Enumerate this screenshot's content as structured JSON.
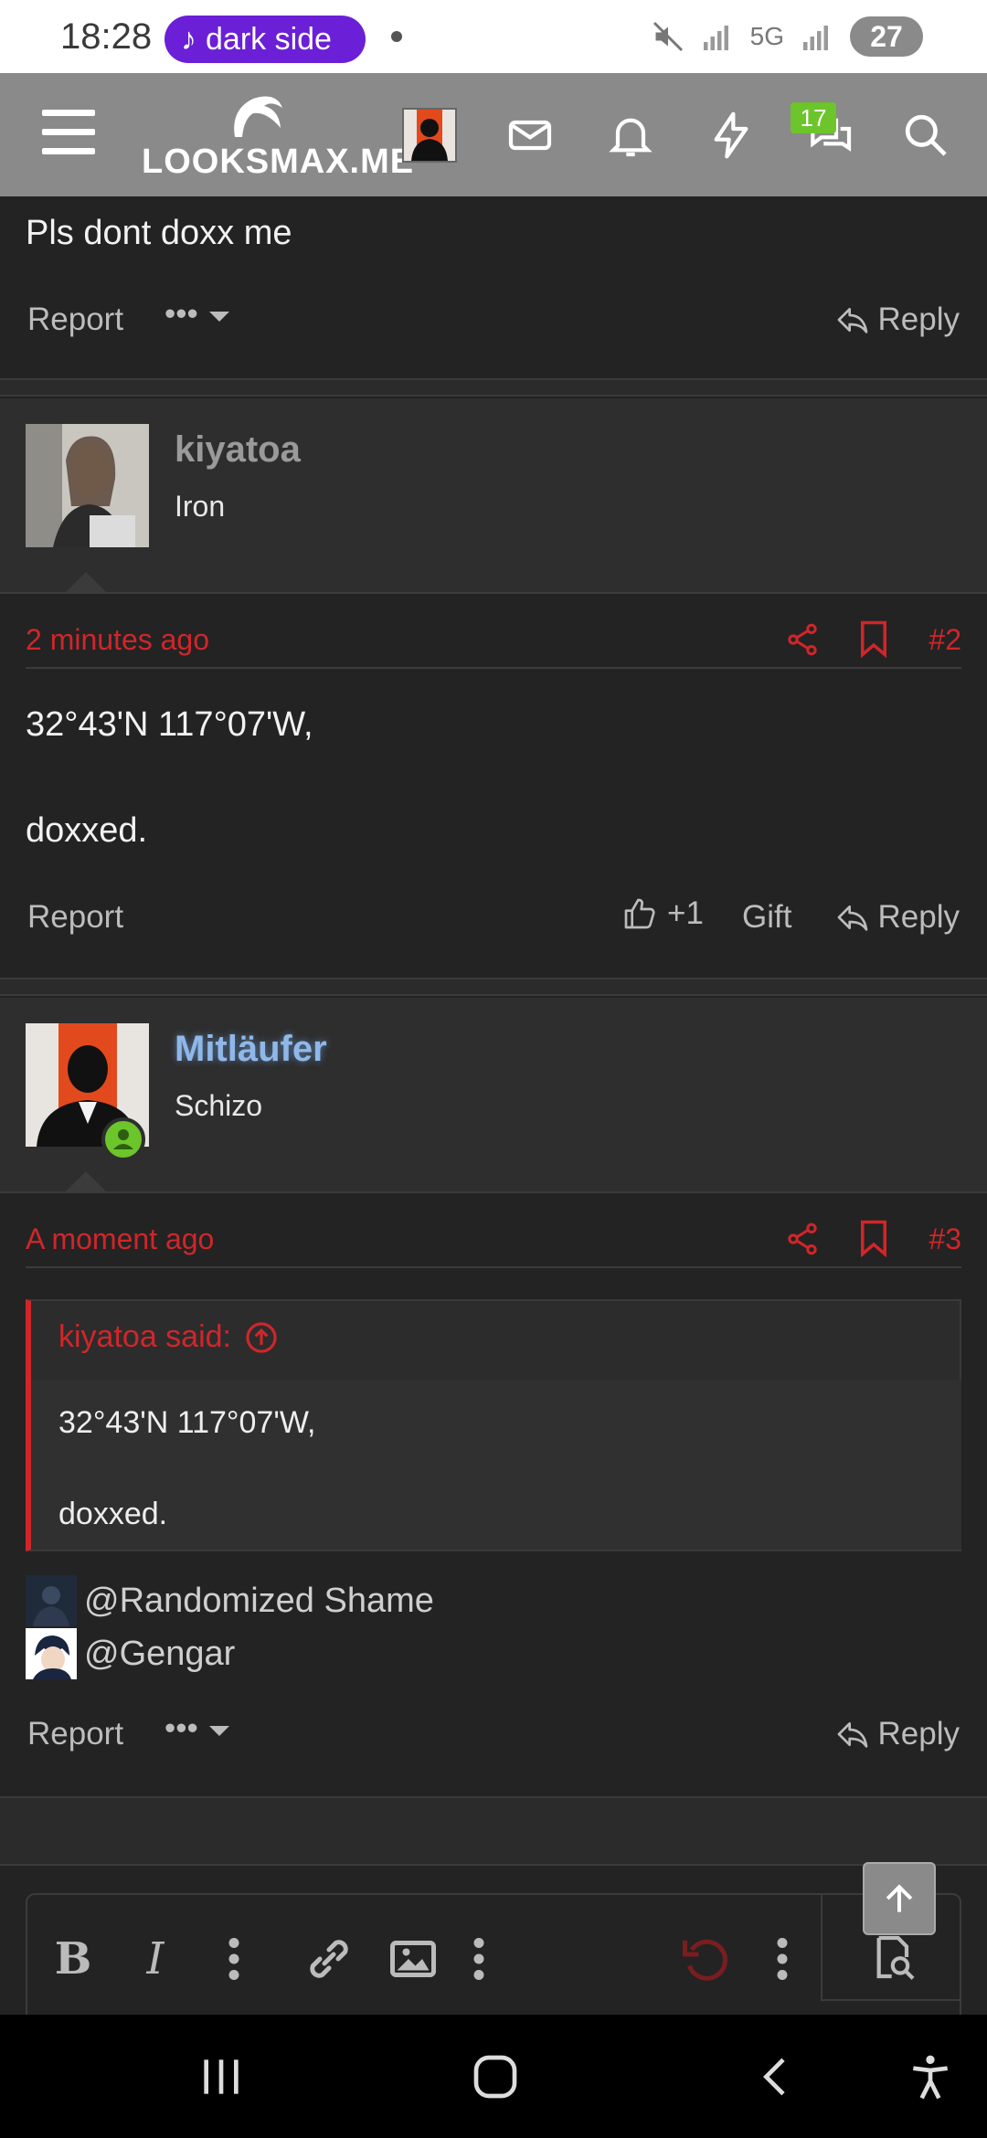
{
  "status_bar": {
    "time": "18:28",
    "music_pill": "dark side",
    "network": "5G",
    "battery": "27"
  },
  "header": {
    "brand": "LOOKSMAX.ME",
    "conversations_badge": "17"
  },
  "post1": {
    "text_fragment": "Pls dont doxx me",
    "report_label": "Report",
    "reply_label": "Reply"
  },
  "post2": {
    "username": "kiyatoa",
    "user_title": "Iron",
    "time": "2 minutes ago",
    "number": "#2",
    "body": "32°43'N 117°07'W,\n\ndoxxed.",
    "report_label": "Report",
    "like_count": "+1",
    "gift_label": "Gift",
    "reply_label": "Reply"
  },
  "post3": {
    "username": "Mitläufer",
    "user_title": "Schizo",
    "time": "A moment ago",
    "number": "#3",
    "quote_author": "kiyatoa said:",
    "quote_body": "32°43'N 117°07'W,\n\ndoxxed.",
    "mentions": [
      "@Randomized Shame",
      "@Gengar"
    ],
    "report_label": "Report",
    "reply_label": "Reply"
  },
  "colors": {
    "accent_red": "#d0262a",
    "header_gray": "#8a8a8a",
    "online_green": "#6cc52a",
    "username_blue": "#8fb8e8"
  }
}
